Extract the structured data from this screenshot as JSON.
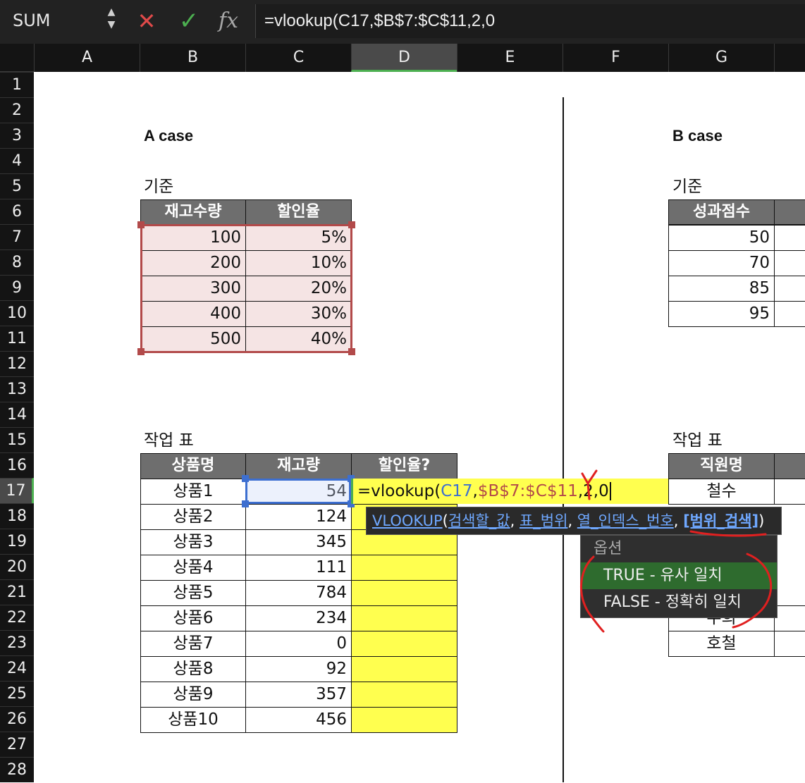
{
  "formula_bar": {
    "name_box": "SUM",
    "fx": "fx",
    "formula": "=vlookup(C17,$B$7:$C$11,2,0"
  },
  "columns": [
    "A",
    "B",
    "C",
    "D",
    "E",
    "F",
    "G"
  ],
  "rows": [
    "1",
    "2",
    "3",
    "4",
    "5",
    "6",
    "7",
    "8",
    "9",
    "10",
    "11",
    "12",
    "13",
    "14",
    "15",
    "16",
    "17",
    "18",
    "19",
    "20",
    "21",
    "22",
    "23",
    "24",
    "25",
    "26",
    "27",
    "28"
  ],
  "a_case": {
    "title": "A case",
    "criteria_label": "기준",
    "criteria_headers": [
      "재고수량",
      "할인율"
    ],
    "criteria_rows": [
      [
        "100",
        "5%"
      ],
      [
        "200",
        "10%"
      ],
      [
        "300",
        "20%"
      ],
      [
        "400",
        "30%"
      ],
      [
        "500",
        "40%"
      ]
    ],
    "work_label": "작업 표",
    "work_headers": [
      "상품명",
      "재고량",
      "할인율?"
    ],
    "work_rows": [
      [
        "상품1",
        "54"
      ],
      [
        "상품2",
        "124"
      ],
      [
        "상품3",
        "345"
      ],
      [
        "상품4",
        "111"
      ],
      [
        "상품5",
        "784"
      ],
      [
        "상품6",
        "234"
      ],
      [
        "상품7",
        "0"
      ],
      [
        "상품8",
        "92"
      ],
      [
        "상품9",
        "357"
      ],
      [
        "상품10",
        "456"
      ]
    ]
  },
  "b_case": {
    "title": "B case",
    "criteria_label": "기준",
    "criteria_header": "성과점수",
    "criteria_values": [
      "50",
      "70",
      "85",
      "95"
    ],
    "work_label": "작업 표",
    "work_header": "직원명",
    "work_values": [
      "철수",
      "",
      "",
      "",
      "",
      "우희",
      "호철"
    ]
  },
  "editing": {
    "prefix": "=vlookup(",
    "ref1": "C17",
    "sep1": ",",
    "ref2": "$B$7:$C$11",
    "rest": ",2,0"
  },
  "tooltip": {
    "func": "VLOOKUP",
    "open": "(",
    "arg1": "검색할_값",
    "arg2": "표_범위",
    "arg3": "열_인덱스_번호",
    "arg4": "[범위_검색]",
    "close": ")",
    "comma": ", "
  },
  "dropdown": {
    "header": "옵션",
    "items": [
      "TRUE - 유사 일치",
      "FALSE - 정확히 일치"
    ]
  },
  "colors": {
    "selection_red": "#b24a4a",
    "selection_blue": "#3d6fd0",
    "highlight_yellow": "#ffff4f",
    "accent_green": "#4caf50"
  }
}
